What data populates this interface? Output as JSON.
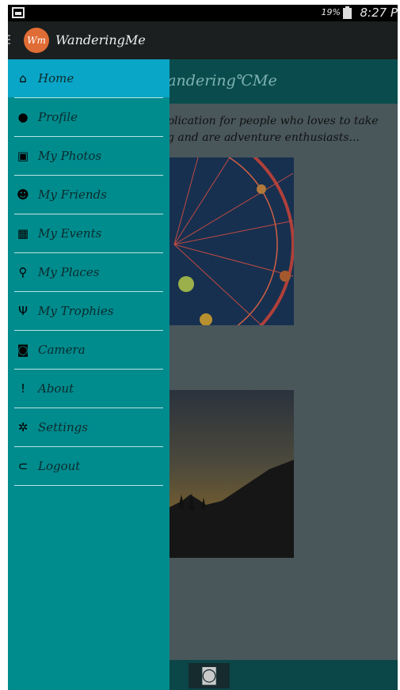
{
  "status_bar": {
    "battery": "19%",
    "time": "8:27 P"
  },
  "app_bar": {
    "title": "WanderingMe",
    "logo_text": "Wm"
  },
  "content": {
    "brand": "'andering℃Me",
    "description": "plication for people who loves to take\ng and are adventure enthusiasts..."
  },
  "drawer": {
    "items": [
      {
        "label": "Home",
        "icon": "home-icon",
        "glyph": "⌂",
        "active": true
      },
      {
        "label": "Profile",
        "icon": "profile-icon",
        "glyph": "●"
      },
      {
        "label": "My Photos",
        "icon": "photos-icon",
        "glyph": "▣"
      },
      {
        "label": "My Friends",
        "icon": "friends-icon",
        "glyph": "☻"
      },
      {
        "label": "My Events",
        "icon": "calendar-icon",
        "glyph": "▦"
      },
      {
        "label": "My Places",
        "icon": "map-pin-icon",
        "glyph": "⚲"
      },
      {
        "label": "My Trophies",
        "icon": "trophy-icon",
        "glyph": "Ψ"
      },
      {
        "label": "Camera",
        "icon": "camera-icon",
        "glyph": "◙"
      },
      {
        "label": "About",
        "icon": "info-icon",
        "glyph": "!"
      },
      {
        "label": "Settings",
        "icon": "gear-icon",
        "glyph": "✲"
      },
      {
        "label": "Logout",
        "icon": "logout-icon",
        "glyph": "⊂"
      }
    ]
  },
  "bottom_bar": {
    "camera_glyph": "◙"
  },
  "colors": {
    "drawer_bg": "#008b8d",
    "drawer_active": "#0aa6c7",
    "app_bar": "#1c1f1f",
    "logo": "#e06d35"
  }
}
